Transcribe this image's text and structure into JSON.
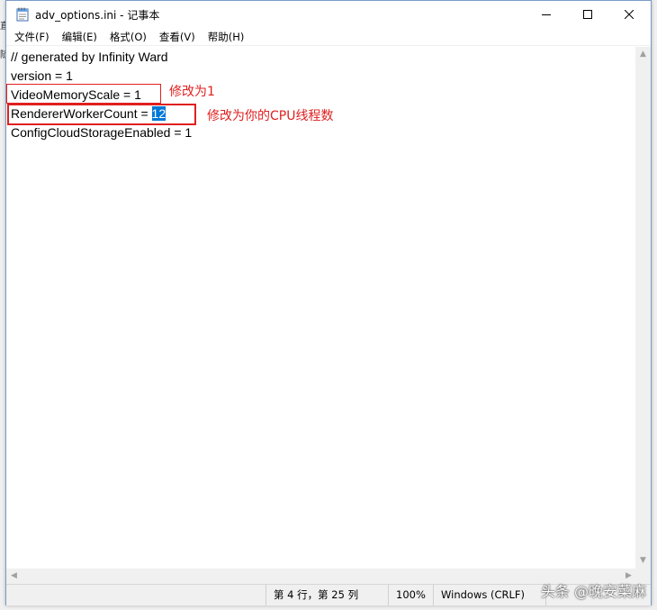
{
  "window": {
    "title": "adv_options.ini - 记事本"
  },
  "menu": {
    "items": [
      "文件(F)",
      "编辑(E)",
      "格式(O)",
      "查看(V)",
      "帮助(H)"
    ]
  },
  "editor": {
    "lines": [
      "// generated by Infinity Ward",
      "version = 1",
      "VideoMemoryScale = 1",
      "RendererWorkerCount = ",
      "ConfigCloudStorageEnabled = 1"
    ],
    "selected_text": "12"
  },
  "annotations": {
    "note1": "修改为1",
    "note2": "修改为你的CPU线程数",
    "color": "#e02020"
  },
  "status": {
    "position": "第 4 行，第 25 列",
    "zoom": "100%",
    "line_ending": "Windows (CRLF)"
  },
  "watermark": "头条 @晚安菜麻",
  "colors": {
    "selection": "#0078d7",
    "annotation": "#e02020"
  }
}
